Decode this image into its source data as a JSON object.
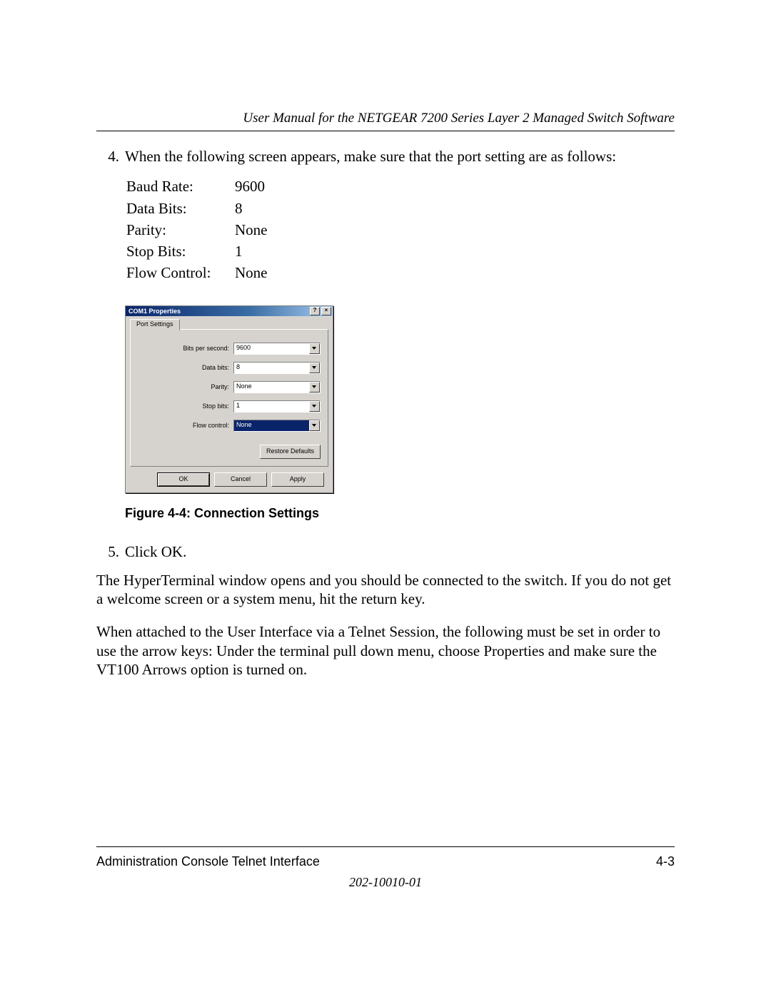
{
  "header": {
    "title": "User Manual for the NETGEAR 7200 Series Layer 2 Managed Switch Software"
  },
  "step4": {
    "number": "4.",
    "text": "When the following screen appears, make sure that the port setting are as follows:"
  },
  "port_settings": [
    {
      "label": "Baud Rate:",
      "value": "9600"
    },
    {
      "label": "Data Bits:",
      "value": "8"
    },
    {
      "label": "Parity:",
      "value": "None"
    },
    {
      "label": "Stop Bits:",
      "value": "1"
    },
    {
      "label": "Flow Control:",
      "value": "None"
    }
  ],
  "dialog": {
    "title": "COM1 Properties",
    "help_btn": "?",
    "close_btn": "×",
    "tab_label": "Port Settings",
    "fields": {
      "bits_per_second": {
        "label": "Bits per second:",
        "value": "9600"
      },
      "data_bits": {
        "label": "Data bits:",
        "value": "8"
      },
      "parity": {
        "label": "Parity:",
        "value": "None"
      },
      "stop_bits": {
        "label": "Stop bits:",
        "value": "1"
      },
      "flow_control": {
        "label": "Flow control:",
        "value": "None"
      }
    },
    "restore_defaults": "Restore Defaults",
    "ok": "OK",
    "cancel": "Cancel",
    "apply": "Apply"
  },
  "figure_caption": "Figure 4-4:  Connection Settings",
  "step5": {
    "number": "5.",
    "text": "Click OK."
  },
  "para1": "The HyperTerminal window opens and you should be connected to the switch. If you do not get a welcome screen or a system menu, hit the return key.",
  "para2": "When attached to the User Interface via a Telnet Session, the following must be set in order to use the arrow keys: Under the terminal pull down menu, choose Properties and make sure the VT100 Arrows option is turned on.",
  "footer": {
    "left": "Administration Console Telnet Interface",
    "right": "4-3",
    "docnum": "202-10010-01"
  }
}
